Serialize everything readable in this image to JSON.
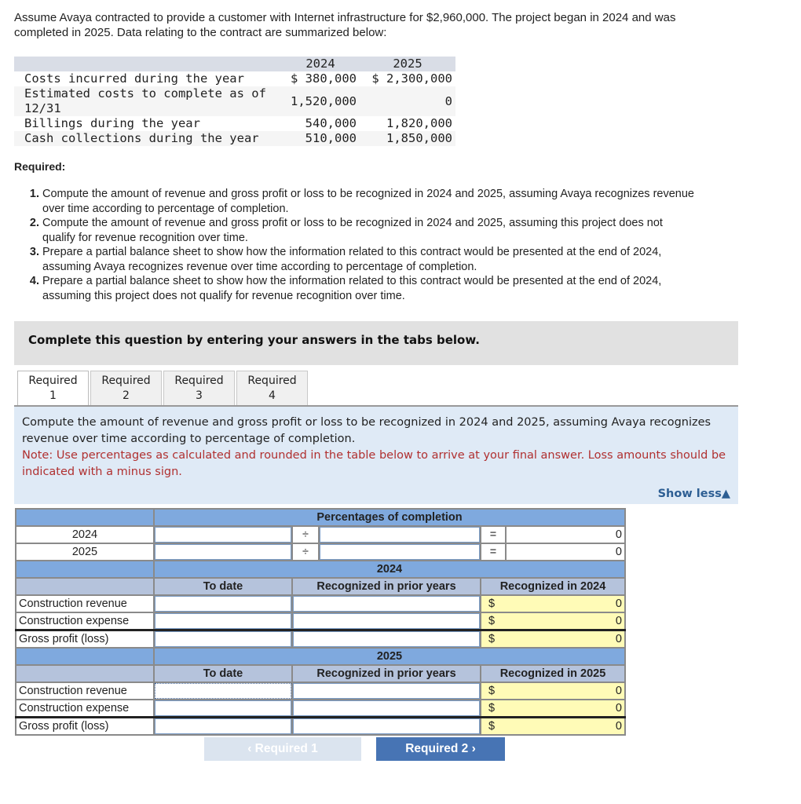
{
  "intro": "Assume Avaya contracted to provide a customer with Internet infrastructure for $2,960,000. The project began in 2024 and was completed in 2025. Data relating to the contract are summarized below:",
  "contract_table": {
    "headers": [
      "",
      "2024",
      "2025"
    ],
    "rows": [
      {
        "label": "Costs incurred during the year",
        "y2024": "$ 380,000",
        "y2025": "$ 2,300,000"
      },
      {
        "label": "Estimated costs to complete as of 12/31",
        "y2024": "1,520,000",
        "y2025": "0"
      },
      {
        "label": "Billings during the year",
        "y2024": "540,000",
        "y2025": "1,820,000"
      },
      {
        "label": "Cash collections during the year",
        "y2024": "510,000",
        "y2025": "1,850,000"
      }
    ]
  },
  "required_title": "Required:",
  "requirements": [
    "Compute the amount of revenue and gross profit or loss to be recognized in 2024 and 2025, assuming Avaya recognizes revenue over time according to percentage of completion.",
    "Compute the amount of revenue and gross profit or loss to be recognized in 2024 and 2025, assuming this project does not qualify for revenue recognition over time.",
    "Prepare a partial balance sheet to show how the information related to this contract would be presented at the end of 2024, assuming Avaya recognizes revenue over time according to percentage of completion.",
    "Prepare a partial balance sheet to show how the information related to this contract would be presented at the end of 2024, assuming this project does not qualify for revenue recognition over time."
  ],
  "banner": "Complete this question by entering your answers in the tabs below.",
  "tabs": [
    {
      "line1": "Required",
      "line2": "1",
      "active": true
    },
    {
      "line1": "Required",
      "line2": "2",
      "active": false
    },
    {
      "line1": "Required",
      "line2": "3",
      "active": false
    },
    {
      "line1": "Required",
      "line2": "4",
      "active": false
    }
  ],
  "instructions": {
    "text": "Compute the amount of revenue and gross profit or loss to be recognized in 2024 and 2025, assuming Avaya recognizes revenue over time according to percentage of completion.",
    "note": "Note: Use percentages as calculated and rounded in the table below to arrive at your final answer. Loss amounts should be indicated with a minus sign.",
    "show_less": "Show less▲"
  },
  "answer_grid": {
    "pct_header": "Percentages of completion",
    "pct_rows": [
      {
        "year": "2024",
        "div": "÷",
        "eq": "=",
        "result": "0"
      },
      {
        "year": "2025",
        "div": "÷",
        "eq": "=",
        "result": "0"
      }
    ],
    "sections": [
      {
        "year": "2024",
        "col_to_date": "To date",
        "col_prior": "Recognized in prior years",
        "col_current": "Recognized in 2024",
        "rows": [
          {
            "label": "Construction revenue",
            "currency": "$",
            "value": "0"
          },
          {
            "label": "Construction expense",
            "currency": "$",
            "value": "0"
          },
          {
            "label": "Gross profit (loss)",
            "currency": "$",
            "value": "0"
          }
        ]
      },
      {
        "year": "2025",
        "col_to_date": "To date",
        "col_prior": "Recognized in prior years",
        "col_current": "Recognized in 2025",
        "rows": [
          {
            "label": "Construction revenue",
            "currency": "$",
            "value": "0"
          },
          {
            "label": "Construction expense",
            "currency": "$",
            "value": "0"
          },
          {
            "label": "Gross profit (loss)",
            "currency": "$",
            "value": "0"
          }
        ]
      }
    ]
  },
  "nav": {
    "prev": "‹  Required 1",
    "next": "Required 2  ›"
  }
}
